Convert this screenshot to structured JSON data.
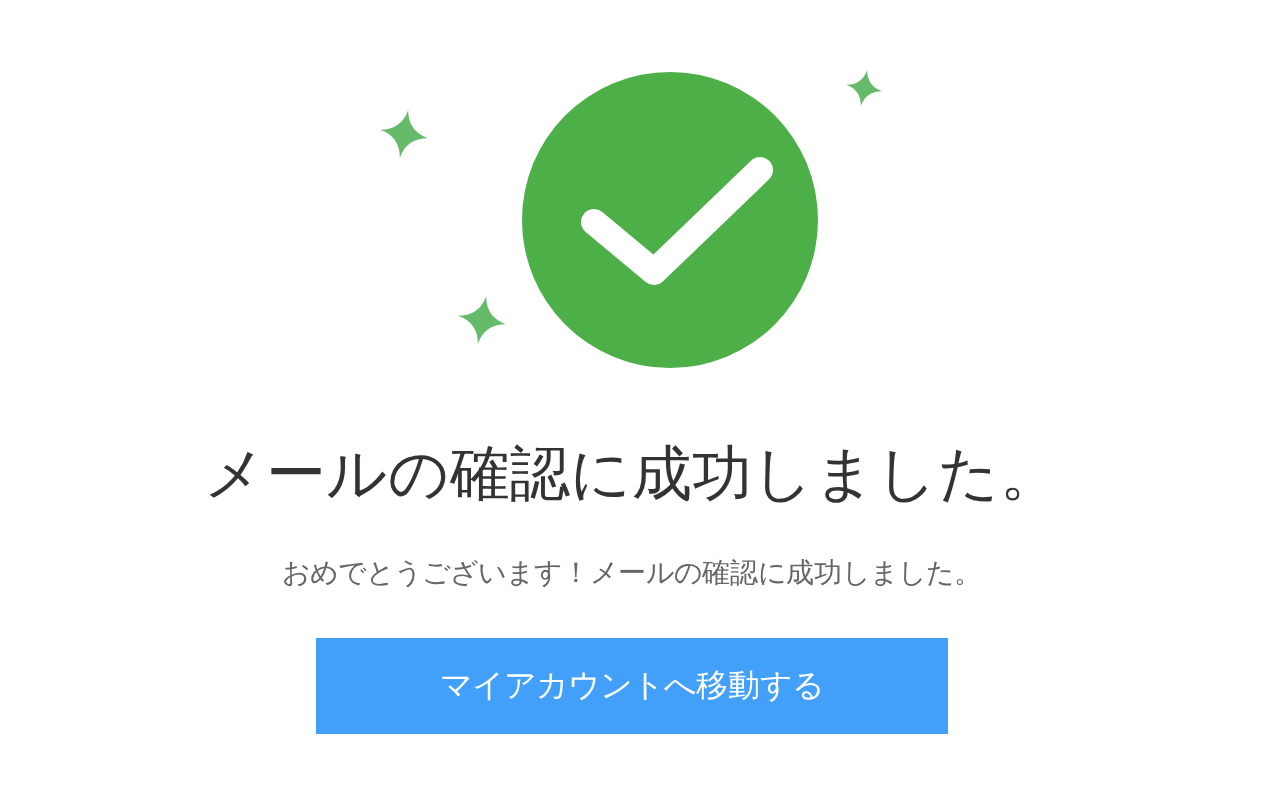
{
  "title": "メールの確認に成功しました。",
  "message": "おめでとうございます！メールの確認に成功しました。",
  "button": {
    "label": "マイアカウントへ移動する"
  }
}
